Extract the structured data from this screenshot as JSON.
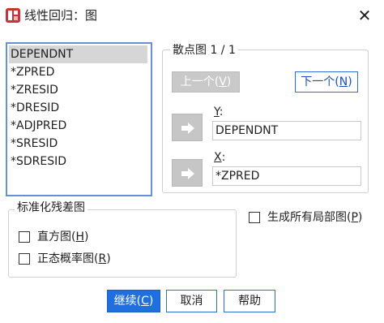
{
  "window": {
    "title": "线性回归：图",
    "close_glyph": "✕"
  },
  "variables": {
    "items": [
      "DEPENDNT",
      "*ZPRED",
      "*ZRESID",
      "*DRESID",
      "*ADJPRED",
      "*SRESID",
      "*SDRESID"
    ],
    "selected": "DEPENDNT"
  },
  "scatter": {
    "legend": "散点图 1 / 1",
    "prev_label": "上一个(",
    "prev_mnemonic": "V",
    "prev_suffix": ")",
    "next_label": "下一个(",
    "next_mnemonic": "N",
    "next_suffix": ")",
    "y_label_letter": "Y",
    "y_label_suffix": ":",
    "y_value": "DEPENDNT",
    "x_label_letter": "X",
    "x_label_suffix": ":",
    "x_value": "*ZPRED"
  },
  "residual_plots": {
    "legend": "标准化残差图",
    "histogram_label": "直方图(",
    "histogram_mnemonic": "H",
    "histogram_suffix": ")",
    "normal_label": "正态概率图(",
    "normal_mnemonic": "R",
    "normal_suffix": ")"
  },
  "partial_plots": {
    "label": "生成所有局部图(",
    "mnemonic": "P",
    "suffix": ")"
  },
  "buttons": {
    "continue_label": "继续(",
    "continue_mnemonic": "C",
    "continue_suffix": ")",
    "cancel_label": "取消",
    "help_label": "帮助"
  },
  "colors": {
    "accent_blue": "#1f6fdf",
    "list_border": "#6b8fd6",
    "disabled_gray": "#c9c9c9",
    "app_icon_red": "#c8323a"
  },
  "icons": [
    "app-icon",
    "close-icon",
    "arrow-right-icon"
  ]
}
